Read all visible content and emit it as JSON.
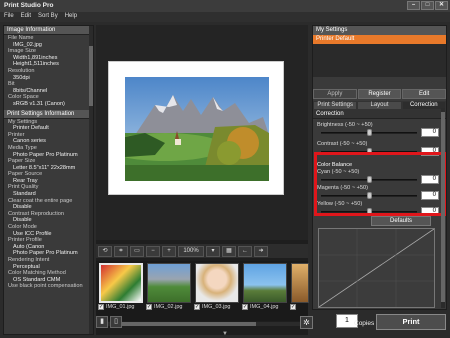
{
  "window": {
    "title": "Print Studio Pro",
    "min": "–",
    "max": "□",
    "close": "✕"
  },
  "menu": [
    "File",
    "Edit",
    "Sort By",
    "Help"
  ],
  "left": {
    "image_info_title": "Image Information",
    "image_info": [
      {
        "label": "File Name",
        "value": "IMG_02.jpg"
      },
      {
        "label": "Image Size",
        "value": "Width1,891inches"
      },
      {
        "label": "",
        "value": "Height1,511inches"
      },
      {
        "label": "Resolution",
        "value": "350dpi"
      },
      {
        "label": "Bit",
        "value": "8bits/Channel"
      },
      {
        "label": "Color Space",
        "value": "sRGB v1.31 (Canon)"
      }
    ],
    "print_info_title": "Print Settings Information",
    "print_info": [
      {
        "label": "My Settings",
        "value": "Printer Default"
      },
      {
        "label": "Printer",
        "value": "Canon                series"
      },
      {
        "label": "Media Type",
        "value": "Photo Paper Pro Platinum"
      },
      {
        "label": "Paper Size",
        "value": "Letter 8.5\"x11\" 22x28mm"
      },
      {
        "label": "Paper Source",
        "value": "Rear Tray"
      },
      {
        "label": "Print Quality",
        "value": "Standard"
      },
      {
        "label": "Clear coat the entire page",
        "value": "Disable"
      },
      {
        "label": "Contrast Reproduction",
        "value": "Disable"
      },
      {
        "label": "Color Mode",
        "value": "Use ICC Profile"
      },
      {
        "label": "Printer Profile",
        "value": "Auto (Canon"
      },
      {
        "label": "",
        "value": "Photo Paper Pro Platinum"
      },
      {
        "label": "Rendering Intent",
        "value": "Perceptual"
      },
      {
        "label": "Color Matching Method",
        "value": "OS Standard CMM"
      },
      {
        "label": "Use black point compensation",
        "value": ""
      }
    ]
  },
  "toolbar": {
    "zoom": "100%",
    "minus_icon": "−",
    "plus_icon": "+",
    "fit_icon": "▭",
    "arrow_right": "➜"
  },
  "thumbnails": [
    {
      "name": "IMG_01.jpg",
      "checked": true
    },
    {
      "name": "IMG_02.jpg",
      "checked": true
    },
    {
      "name": "IMG_03.jpg",
      "checked": true
    },
    {
      "name": "IMG_04.jpg",
      "checked": true
    },
    {
      "name": "IMG_05.jpg",
      "checked": true
    }
  ],
  "right": {
    "my_settings_title": "My Settings",
    "my_settings_item": "Printer Default",
    "apply": "Apply",
    "register": "Register",
    "edit": "Edit",
    "tabs": [
      "Print Settings",
      "Layout",
      "Correction"
    ],
    "correction_title": "Correction",
    "brightness_label": "Brightness (-50 ~ +50)",
    "brightness_value": "0",
    "contrast_label": "Contrast (-50 ~ +50)",
    "contrast_value": "0",
    "color_balance_title": "Color Balance",
    "cyan_label": "Cyan (-50 ~ +50)",
    "cyan_value": "0",
    "magenta_label": "Magenta (-50 ~ +50)",
    "magenta_value": "0",
    "yellow_label": "Yellow (-50 ~ +50)",
    "yellow_value": "0",
    "defaults": "Defaults"
  },
  "bottom": {
    "copies": "1",
    "copies_label": "Copies",
    "print": "Print"
  }
}
